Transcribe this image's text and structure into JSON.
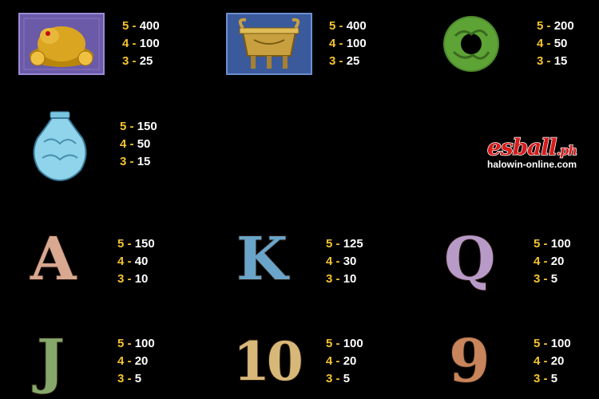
{
  "symbols": [
    {
      "icon": "golden-toad-icon",
      "pays": [
        {
          "count": "5",
          "value": "400"
        },
        {
          "count": "4",
          "value": "100"
        },
        {
          "count": "3",
          "value": "25"
        }
      ]
    },
    {
      "icon": "bronze-cauldron-icon",
      "pays": [
        {
          "count": "5",
          "value": "400"
        },
        {
          "count": "4",
          "value": "100"
        },
        {
          "count": "3",
          "value": "25"
        }
      ]
    },
    {
      "icon": "jade-disc-icon",
      "pays": [
        {
          "count": "5",
          "value": "200"
        },
        {
          "count": "4",
          "value": "50"
        },
        {
          "count": "3",
          "value": "15"
        }
      ]
    },
    {
      "icon": "porcelain-vase-icon",
      "pays": [
        {
          "count": "5",
          "value": "150"
        },
        {
          "count": "4",
          "value": "50"
        },
        {
          "count": "3",
          "value": "15"
        }
      ]
    },
    {
      "icon": "letter-a-icon",
      "glyph": "A",
      "pays": [
        {
          "count": "5",
          "value": "150"
        },
        {
          "count": "4",
          "value": "40"
        },
        {
          "count": "3",
          "value": "10"
        }
      ]
    },
    {
      "icon": "letter-k-icon",
      "glyph": "K",
      "pays": [
        {
          "count": "5",
          "value": "125"
        },
        {
          "count": "4",
          "value": "30"
        },
        {
          "count": "3",
          "value": "10"
        }
      ]
    },
    {
      "icon": "letter-q-icon",
      "glyph": "Q",
      "pays": [
        {
          "count": "5",
          "value": "100"
        },
        {
          "count": "4",
          "value": "20"
        },
        {
          "count": "3",
          "value": "5"
        }
      ]
    },
    {
      "icon": "letter-j-icon",
      "glyph": "J",
      "pays": [
        {
          "count": "5",
          "value": "100"
        },
        {
          "count": "4",
          "value": "20"
        },
        {
          "count": "3",
          "value": "5"
        }
      ]
    },
    {
      "icon": "number-10-icon",
      "glyph": "10",
      "pays": [
        {
          "count": "5",
          "value": "100"
        },
        {
          "count": "4",
          "value": "20"
        },
        {
          "count": "3",
          "value": "5"
        }
      ]
    },
    {
      "icon": "number-9-icon",
      "glyph": "9",
      "pays": [
        {
          "count": "5",
          "value": "100"
        },
        {
          "count": "4",
          "value": "20"
        },
        {
          "count": "3",
          "value": "5"
        }
      ]
    }
  ],
  "watermark": {
    "brand": "esball",
    "suffix": ".ph",
    "site": "halowin-online.com"
  },
  "colors": {
    "background": "#000000",
    "count": "#f4c430",
    "value": "#ffffff",
    "brand": "#d81a1a"
  }
}
